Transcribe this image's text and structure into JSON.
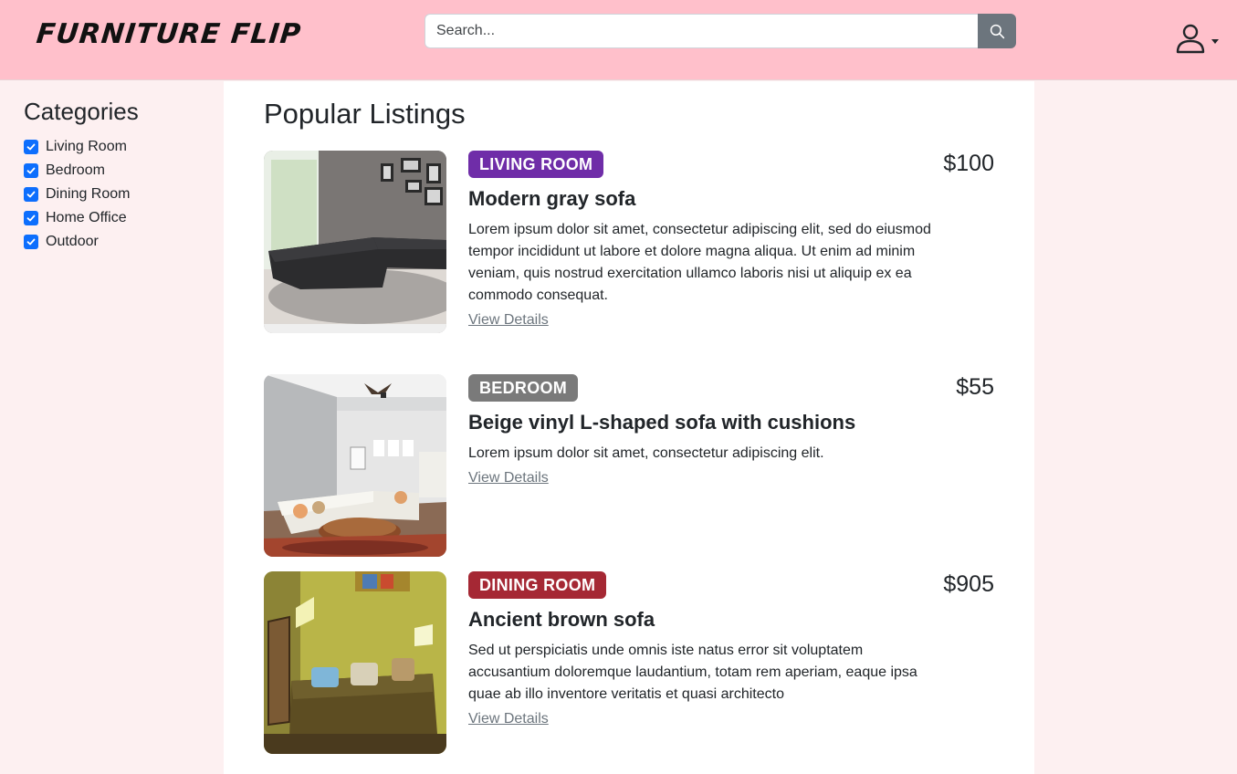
{
  "brand": {
    "logo_text": "FURNITURE FLIP"
  },
  "search": {
    "placeholder": "Search..."
  },
  "sidebar": {
    "title": "Categories",
    "items": [
      {
        "label": "Living Room"
      },
      {
        "label": "Bedroom"
      },
      {
        "label": "Dining Room"
      },
      {
        "label": "Home Office"
      },
      {
        "label": "Outdoor"
      }
    ]
  },
  "main": {
    "title": "Popular Listings"
  },
  "listings": [
    {
      "category": "LIVING ROOM",
      "category_color": "#6f2da8",
      "title": "Modern gray sofa",
      "description": "Lorem ipsum dolor sit amet, consectetur adipiscing elit, sed do eiusmod tempor incididunt ut labore et dolore magna aliqua. Ut enim ad minim veniam, quis nostrud exercitation ullamco laboris nisi ut aliquip ex ea commodo consequat.",
      "link": "View Details",
      "price": "$100"
    },
    {
      "category": "BEDROOM",
      "category_color": "#7a7a7a",
      "title": "Beige vinyl L-shaped sofa with cushions",
      "description": "Lorem ipsum dolor sit amet, consectetur adipiscing elit.",
      "link": "View Details",
      "price": "$55"
    },
    {
      "category": "DINING ROOM",
      "category_color": "#a52834",
      "title": "Ancient brown sofa",
      "description": "Sed ut perspiciatis unde omnis iste natus error sit voluptatem accusantium doloremque laudantium, totam rem aperiam, eaque ipsa quae ab illo inventore veritatis et quasi architecto",
      "link": "View Details",
      "price": "$905"
    }
  ],
  "colors": {
    "navbar": "#ffc0cb",
    "sidebar": "#fdf0f1",
    "checkbox": "#0d6efd",
    "search_button": "#6c757d"
  },
  "icons": {
    "search_button": "search-icon",
    "user_menu": "user-icon",
    "checkbox": "check-icon"
  }
}
